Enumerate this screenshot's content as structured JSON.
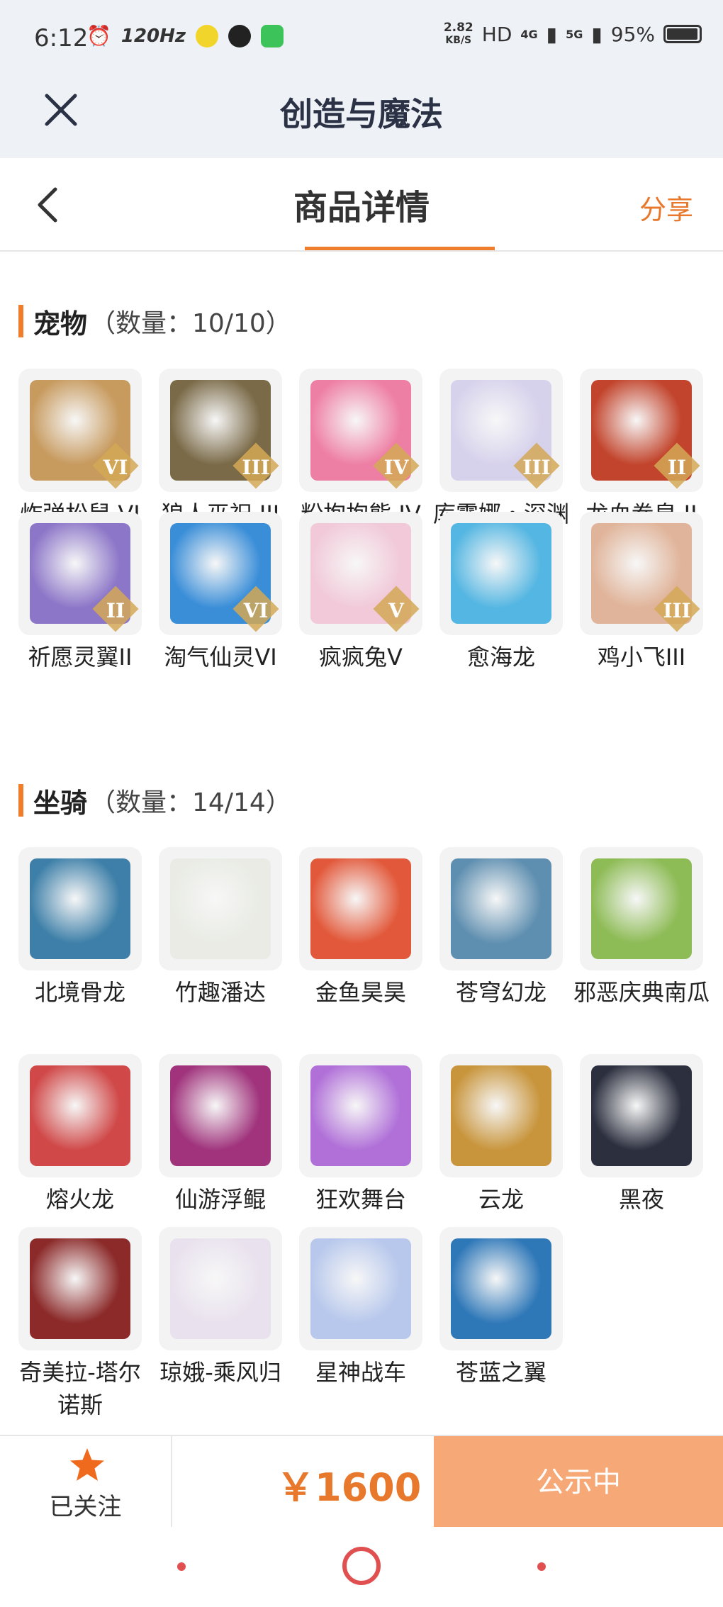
{
  "status_bar": {
    "time": "6:12",
    "refresh": "120Hz",
    "speed_top": "2.82",
    "speed_unit": "KB/S",
    "hd": "HD",
    "net1": "4G",
    "net2": "5G",
    "battery": "95%"
  },
  "app_bar": {
    "title": "创造与魔法"
  },
  "header": {
    "title": "商品详情",
    "share": "分享"
  },
  "pets": {
    "name": "宠物",
    "count": "（数量：10/10）",
    "items": [
      {
        "name": "炸弹松鼠 VI",
        "rank": "VI",
        "color": "#c79a5e"
      },
      {
        "name": "狼人巫祝 III",
        "rank": "III",
        "color": "#7a6a48"
      },
      {
        "name": "粉抱抱熊 IV",
        "rank": "IV",
        "color": "#ee7fa4"
      },
      {
        "name": "库露娜・深渊魅影III",
        "rank": "III",
        "color": "#d7d2ec"
      },
      {
        "name": "龙血拳皇 II",
        "rank": "II",
        "color": "#c2442c"
      },
      {
        "name": "祈愿灵翼II",
        "rank": "II",
        "color": "#8c76c8"
      },
      {
        "name": "淘气仙灵VI",
        "rank": "VI",
        "color": "#3a8ed8"
      },
      {
        "name": "疯疯兔V",
        "rank": "V",
        "color": "#f1c9d8"
      },
      {
        "name": "愈海龙",
        "rank": "",
        "color": "#54b6e2"
      },
      {
        "name": "鸡小飞III",
        "rank": "III",
        "color": "#e0b49a"
      }
    ]
  },
  "mounts": {
    "name": "坐骑",
    "count": "（数量：14/14）",
    "items": [
      {
        "name": "北境骨龙",
        "color": "#3d7fa8"
      },
      {
        "name": "竹趣潘达",
        "color": "#e9ebe4"
      },
      {
        "name": "金鱼昊昊",
        "color": "#e2583a"
      },
      {
        "name": "苍穹幻龙",
        "color": "#5f8fb0"
      },
      {
        "name": "邪恶庆典南瓜",
        "color": "#8dbb55"
      },
      {
        "name": "熔火龙",
        "color": "#d04848"
      },
      {
        "name": "仙游浮鲲",
        "color": "#a0337c"
      },
      {
        "name": "狂欢舞台",
        "color": "#b070d8"
      },
      {
        "name": "云龙",
        "color": "#c8953c"
      },
      {
        "name": "黑夜",
        "color": "#2b2f3e"
      },
      {
        "name": "奇美拉-塔尔诺斯",
        "color": "#8c2a2a"
      },
      {
        "name": "琼娥-乘风归",
        "color": "#e9e2ee"
      },
      {
        "name": "星神战车",
        "color": "#b8c8ec"
      },
      {
        "name": "苍蓝之翼",
        "color": "#2f78b8"
      }
    ]
  },
  "bottom": {
    "follow_label": "已关注",
    "price": "￥1600",
    "status": "公示中"
  },
  "colors": {
    "accent": "#ef7d2b",
    "status_btn": "#f6a877"
  }
}
